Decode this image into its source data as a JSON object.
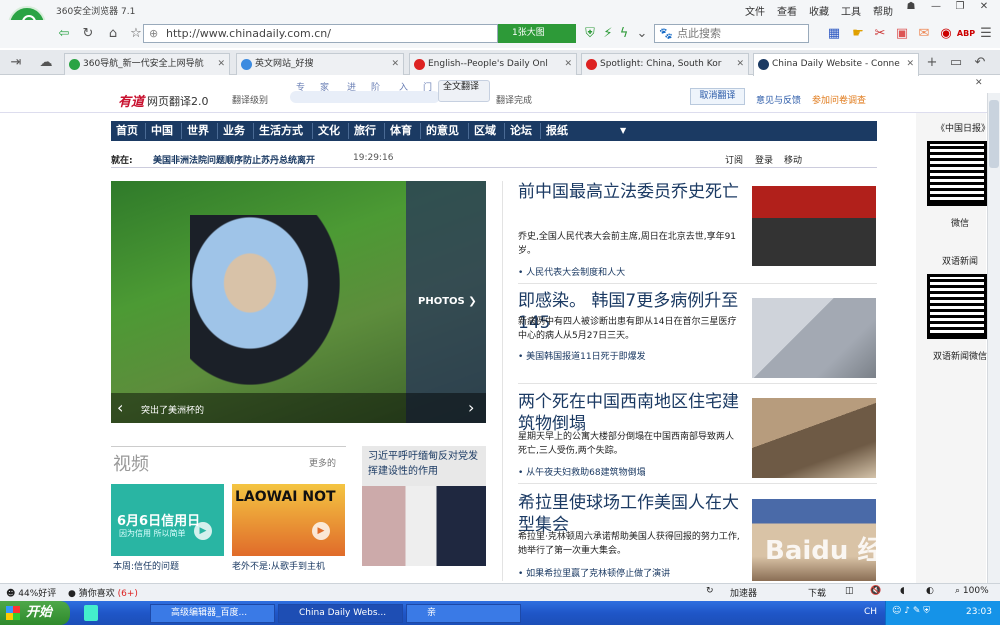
{
  "browser": {
    "title": "360安全浏览器 7.1",
    "menus": [
      "文件",
      "查看",
      "收藏",
      "工具",
      "帮助"
    ],
    "url": "http://www.chinadaily.com.cn/",
    "addr_badge": "1张大图",
    "search_placeholder": "点此搜索"
  },
  "tabs": [
    {
      "label": "360导航_新一代安全上网导航",
      "color": "#2aa344"
    },
    {
      "label": "英文网站_好搜",
      "color": "#3c8be0"
    },
    {
      "label": "English--People's Daily Onl",
      "color": "#d22"
    },
    {
      "label": "Spotlight: China, South Kor",
      "color": "#d22"
    },
    {
      "label": "China Daily Website - Conne",
      "color": "#1b3a63"
    }
  ],
  "translate": {
    "brand": "有道",
    "brand_sub": "网页翻译2.0",
    "level_label": "翻译级别",
    "levels": [
      "专",
      "家",
      "进",
      "阶",
      "入",
      "门"
    ],
    "full": "全文翻译",
    "done": "翻译完成",
    "cancel": "取消翻译",
    "feedback": "意见与反馈",
    "survey": "参加问卷调查"
  },
  "site": {
    "nav": [
      "首页",
      "中国",
      "世界",
      "业务",
      "生活方式",
      "文化",
      "旅行",
      "体育",
      "的意见",
      "区域",
      "论坛",
      "报纸"
    ],
    "ticker_label": "就在:",
    "ticker_text": "美国非洲法院问题顺序防止苏丹总统离开",
    "ticker_time": "19:29:16",
    "ticker_links": [
      "订阅",
      "登录",
      "移动"
    ],
    "hero_caption": "突出了美洲杯的",
    "hero_photos": "PHOTOS",
    "video_title": "视频",
    "video_more": "更多的",
    "video1_caption": "本周:信任的问题",
    "video1_thumb_text": "6月6日信用日",
    "video1_thumb_sub": "因为信用 所以简单",
    "video2_caption": "老外不是:从歌手到主机",
    "video2_thumb_text": "LAOWAI NOT",
    "feature_title": "习近平呼吁缅甸反对党发挥建设性的作用",
    "stories": [
      {
        "title": "前中国最高立法委员乔史死亡",
        "summary": "乔史,全国人民代表大会前主席,周日在北京去世,享年91岁。",
        "link": "人民代表大会制度和人大"
      },
      {
        "title": "即感染。 韩国7更多病例升至145",
        "summary": "新病例中有四人被诊断出患有即从14日在首尔三星医疗中心的病人从5月27日三天。",
        "link": "美国韩国报道11日死于即爆发"
      },
      {
        "title": "两个死在中国西南地区住宅建筑物倒塌",
        "summary": "星期天早上的公寓大楼部分倒塌在中国西南部导致两人死亡,三人受伤,两个失踪。",
        "link": "从午夜夫妇救助68建筑物倒塌"
      },
      {
        "title": "希拉里使球场工作美国人在大型集会",
        "summary": "希拉里·克林顿周六承诺帮助美国人获得回报的努力工作,她举行了第一次重大集会。",
        "link": "如果希拉里赢了克林顿停止做了演讲"
      }
    ],
    "right_title": "《中国日报》",
    "qr1_label": "微信",
    "qr2_title": "双语新闻",
    "qr2_label": "双语新闻微信"
  },
  "status": {
    "rating": "44%好评",
    "guess": "猜你喜欢",
    "guess_count": "(6+)",
    "accel": "加速器",
    "download": "下载",
    "zoom": "100%"
  },
  "taskbar": {
    "start": "开始",
    "tasks": [
      "高级编辑器_百度...",
      "China Daily Webs...",
      "亲"
    ],
    "lang": "CH",
    "time": "23:03"
  },
  "watermark": "Baidu 经验"
}
